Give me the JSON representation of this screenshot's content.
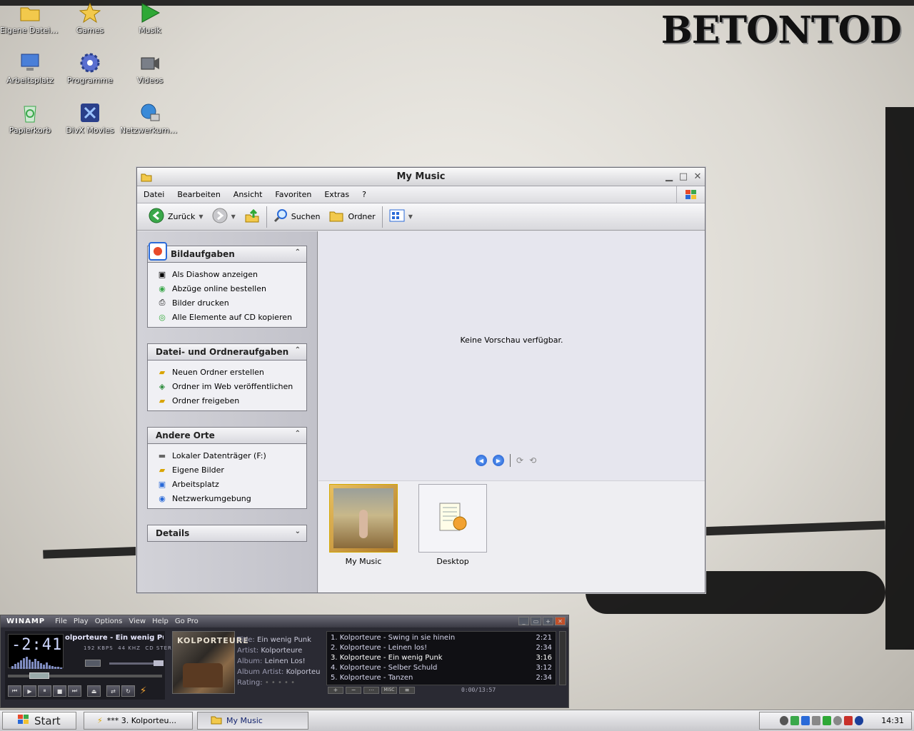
{
  "desktop": {
    "logo": "BETONTOD",
    "icons": [
      {
        "label": "Eigene Dateien",
        "icon": "my-documents-folder-icon",
        "color": "#f2c94c"
      },
      {
        "label": "Games",
        "icon": "star-icon",
        "color": "#f2c94c"
      },
      {
        "label": "Musik",
        "icon": "play-triangle-icon",
        "color": "#2fa836"
      },
      {
        "label": "Arbeitsplatz",
        "icon": "my-computer-icon",
        "color": "#4a7fd8"
      },
      {
        "label": "Programme",
        "icon": "gear-icon",
        "color": "#5a6fd0"
      },
      {
        "label": "Videos",
        "icon": "video-camera-icon",
        "color": "#7a7f88"
      },
      {
        "label": "Papierkorb",
        "icon": "recycle-bin-icon",
        "color": "#3aa84a"
      },
      {
        "label": "DivX Movies",
        "icon": "divx-icon",
        "color": "#2a3f8a"
      },
      {
        "label": "Netzwerkumg...",
        "icon": "network-globe-icon",
        "color": "#3a8ad8"
      }
    ]
  },
  "explorer": {
    "title": "My Music",
    "menu": [
      "Datei",
      "Bearbeiten",
      "Ansicht",
      "Favoriten",
      "Extras",
      "?"
    ],
    "toolbar": {
      "back_label": "Zurück",
      "search_label": "Suchen",
      "folders_label": "Ordner"
    },
    "panels": {
      "bildaufgaben": {
        "title": "Bildaufgaben",
        "items": [
          "Als Diashow anzeigen",
          "Abzüge online bestellen",
          "Bilder drucken",
          "Alle Elemente auf CD kopieren"
        ]
      },
      "datei": {
        "title": "Datei- und Ordneraufgaben",
        "items": [
          "Neuen Ordner erstellen",
          "Ordner im Web veröffentlichen",
          "Ordner freigeben"
        ]
      },
      "orte": {
        "title": "Andere Orte",
        "items": [
          "Lokaler Datenträger (F:)",
          "Eigene Bilder",
          "Arbeitsplatz",
          "Netzwerkumgebung"
        ]
      },
      "details": {
        "title": "Details"
      }
    },
    "preview_message": "Keine Vorschau verfügbar.",
    "thumbnails": [
      {
        "label": "My Music"
      },
      {
        "label": "Desktop"
      }
    ]
  },
  "winamp": {
    "brand": "WINAMP",
    "menu": [
      "File",
      "Play",
      "Options",
      "View",
      "Help",
      "Go Pro"
    ],
    "time": "-2:41",
    "song_scroll": "olporteure - Ein wenig Punk",
    "kbps": "192",
    "khz": "44",
    "mode": "STEREO",
    "album_art_text": "KOLPORTEURE",
    "meta": {
      "title_key": "Title:",
      "title_val": "Ein wenig Punk",
      "artist_key": "Artist:",
      "artist_val": "Kolporteure",
      "album_key": "Album:",
      "album_val": "Leinen Los!",
      "album_artist_key": "Album Artist:",
      "album_artist_val": "Kolporteu",
      "rating_key": "Rating:"
    },
    "playlist": [
      {
        "name": "1. Kolporteure - Swing in sie hinein",
        "len": "2:21"
      },
      {
        "name": "2. Kolporteure - Leinen los!",
        "len": "2:34"
      },
      {
        "name": "3. Kolporteure - Ein wenig Punk",
        "len": "3:16"
      },
      {
        "name": "4. Kolporteure - Selber Schuld",
        "len": "3:12"
      },
      {
        "name": "5. Kolporteure - Tanzen",
        "len": "2:34"
      }
    ],
    "playlist_time": "0:00/13:57",
    "misc_label": "MISC"
  },
  "taskbar": {
    "start_label": "Start",
    "tasks": [
      {
        "label": "*** 3. Kolporteu..."
      },
      {
        "label": "My Music"
      }
    ],
    "clock": "14:31"
  }
}
